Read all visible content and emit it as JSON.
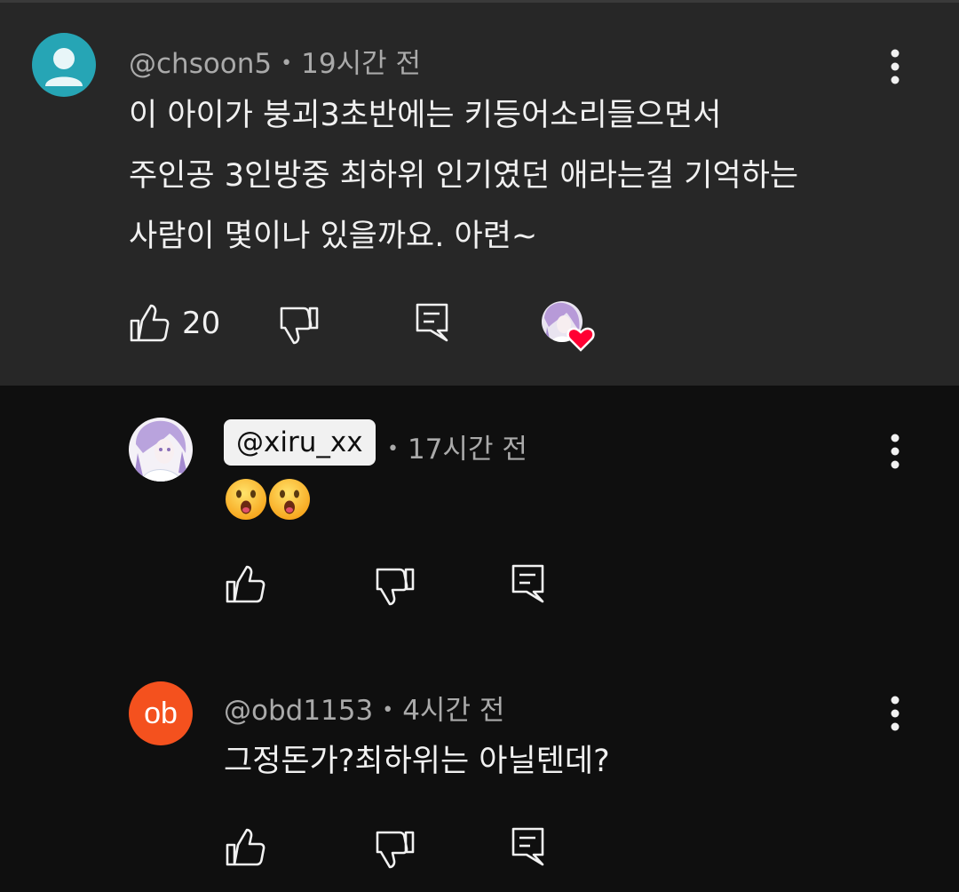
{
  "comments": [
    {
      "handle": "@chsoon5",
      "time": "19시간 전",
      "lines": [
        "이 아이가 붕괴3초반에는 키등어소리들으면서",
        "주인공 3인방중 최하위 인기였던 애라는걸 기억하는",
        "사람이 몇이나 있을까요. 아련~"
      ],
      "likes": "20",
      "avatar_icon": "default-user-icon",
      "avatar_color": "#26a5b5"
    },
    {
      "handle": "@xiru_xx",
      "time": "17시간 전",
      "emoji": [
        "😮",
        "😮"
      ],
      "owner": true
    },
    {
      "handle": "@obd1153",
      "time": "4시간 전",
      "text": "그정돈가?최하위는 아닐텐데?",
      "avatar_text": "ob",
      "avatar_color": "#f4511e"
    }
  ],
  "colors": {
    "highlight_bg": "#272727",
    "page_bg": "#0f0f0f",
    "heart": "#ff0033"
  },
  "icons": [
    "thumb-up-icon",
    "thumb-down-icon",
    "reply-icon",
    "more-vert-icon",
    "creator-heart-icon"
  ]
}
